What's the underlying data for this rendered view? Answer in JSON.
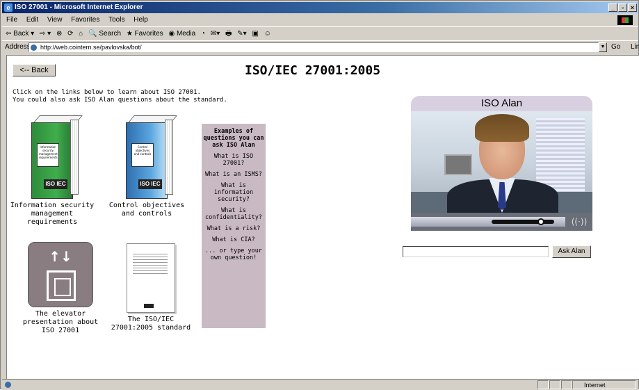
{
  "window": {
    "title": "ISO 27001 - Microsoft Internet Explorer",
    "min": "_",
    "max": "▫",
    "close": "×"
  },
  "menu": [
    "File",
    "Edit",
    "View",
    "Favorites",
    "Tools",
    "Help"
  ],
  "toolbar": [
    "⇦ Back ▾",
    "⇨ ▾",
    "⊗",
    "⟳",
    "⌂",
    "🔍 Search",
    "★ Favorites",
    "◉ Media",
    "◔",
    "✉▾",
    "🖶",
    "✎▾",
    "▣",
    "☺"
  ],
  "address": {
    "label": "Address",
    "url": "http://web.cointern.se/pavlovska/bot/",
    "go": "Go",
    "links": "Lin"
  },
  "page": {
    "back_label": "<-- Back",
    "title": "ISO/IEC 27001:2005",
    "intro_line1": "Click on the links below to learn about ISO 27001.",
    "intro_line2": "You could also ask ISO Alan questions about the standard."
  },
  "links": {
    "isms_caption_1": "Information security",
    "isms_caption_2": "management requirements",
    "isms_label": "Information security management requirements",
    "controls_caption_1": "Control objectives",
    "controls_caption_2": "and controls",
    "controls_label": "Control objectives and controls",
    "elevator_caption_1": "The elevator",
    "elevator_caption_2": "presentation about",
    "elevator_caption_3": "ISO 27001",
    "standard_caption_1": "The ISO/IEC",
    "standard_caption_2": "27001:2005 standard",
    "iso_logo": "ISO IEC"
  },
  "examples": {
    "title": "Examples of questions you can ask ISO Alan",
    "items": [
      "What is ISO 27001?",
      "What is an ISMS?",
      "What is information security?",
      "What is confidentiality?",
      "What is a risk?",
      "What is CIA?",
      "... or type your own question!"
    ]
  },
  "alan": {
    "name": "ISO Alan",
    "progress": 0.92,
    "sound_icon": "((·))",
    "ask_button": "Ask Alan",
    "input_value": ""
  },
  "status": {
    "zone": "Internet"
  },
  "colors": {
    "examples_bg": "#c9b9c3",
    "title_bar": "#0a246a"
  }
}
